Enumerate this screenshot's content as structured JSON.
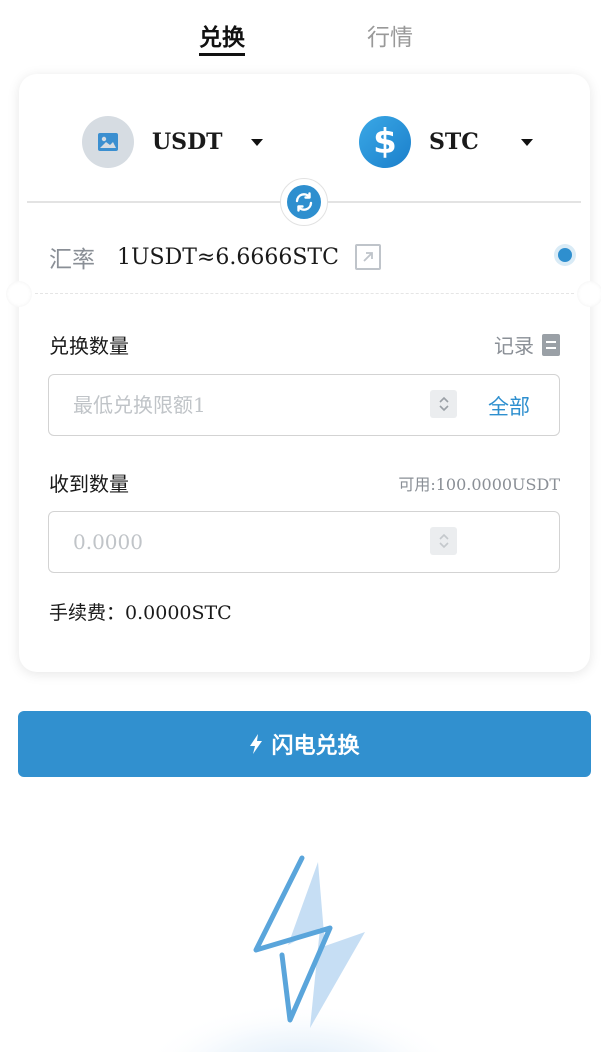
{
  "tabs": [
    {
      "label": "兑换",
      "active": true
    },
    {
      "label": "行情",
      "active": false
    }
  ],
  "from_coin": {
    "name": "USDT",
    "icon": "image-placeholder-icon"
  },
  "to_coin": {
    "name": "STC",
    "icon": "dollar-icon"
  },
  "rate": {
    "label": "汇率",
    "value": "1USDT≈6.6666STC"
  },
  "exchange": {
    "label": "兑换数量",
    "record_label": "记录",
    "placeholder": "最低兑换限额1",
    "all_label": "全部"
  },
  "receive": {
    "label": "收到数量",
    "available": "可用:100.0000USDT",
    "placeholder": "0.0000"
  },
  "fee": {
    "label": "手续费：",
    "value": "0.0000STC"
  },
  "submit_label": "闪电兑换",
  "colors": {
    "accent": "#3190cf",
    "muted": "#8a8f96"
  }
}
